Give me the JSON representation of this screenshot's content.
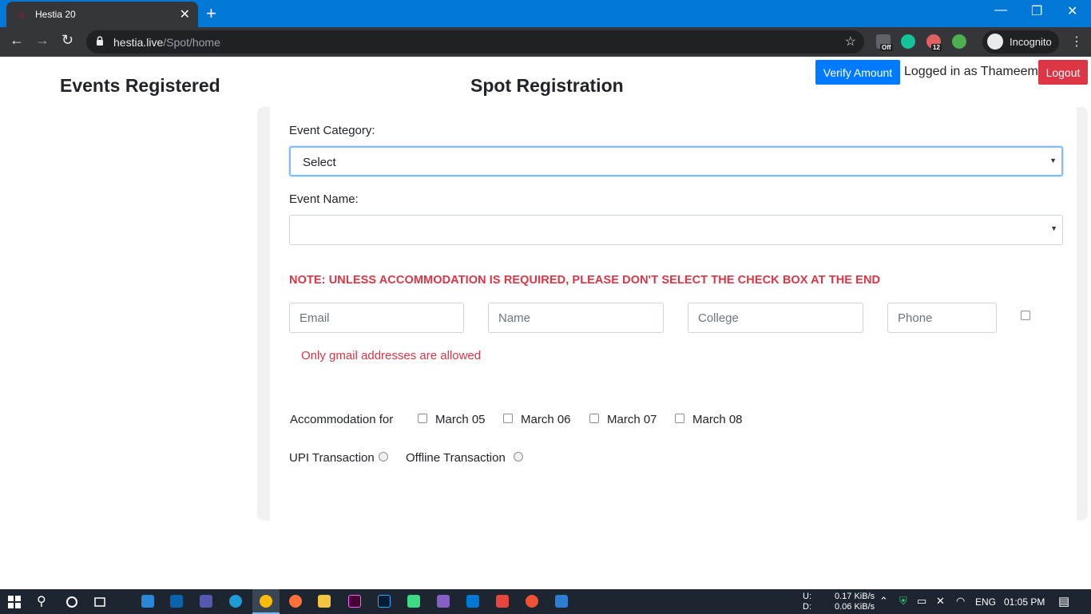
{
  "browser": {
    "tab_title": "Hestia 20",
    "tab_close": "✕",
    "new_tab": "+",
    "url_host": "hestia.live",
    "url_path": "/Spot/home",
    "incognito_label": "Incognito",
    "extension_badge_off": "Off",
    "extension_badge_count": "12"
  },
  "header": {
    "left_title": "Events Registered",
    "center_title": "Spot Registration",
    "verify_button": "Verify Amount",
    "logged_in_text": "Logged in as Thameem",
    "logout_button": "Logout"
  },
  "form": {
    "event_category_label": "Event Category:",
    "event_category_value": "Select",
    "event_name_label": "Event Name:",
    "event_name_value": "",
    "note": "NOTE: UNLESS ACCOMMODATION IS REQUIRED, PLEASE DON'T SELECT THE CHECK BOX AT THE END",
    "email_placeholder": "Email",
    "name_placeholder": "Name",
    "college_placeholder": "College",
    "phone_placeholder": "Phone",
    "error_text": "Only gmail addresses are allowed",
    "accommodation_label": "Accommodation for",
    "dates": [
      "March 05",
      "March 06",
      "March 07",
      "March 08"
    ],
    "upi_label": "UPI Transaction",
    "offline_label": "Offline Transaction"
  },
  "taskbar": {
    "net_up_label": "U:",
    "net_down_label": "D:",
    "net_up": "0.17 KiB/s",
    "net_down": "0.06 KiB/s",
    "language": "ENG",
    "time": "01:05 PM"
  },
  "colors": {
    "primary": "#007bff",
    "danger": "#dc3545",
    "chrome_blue": "#0078d7",
    "toolbar": "#35363a",
    "taskbar": "#1c2530"
  }
}
